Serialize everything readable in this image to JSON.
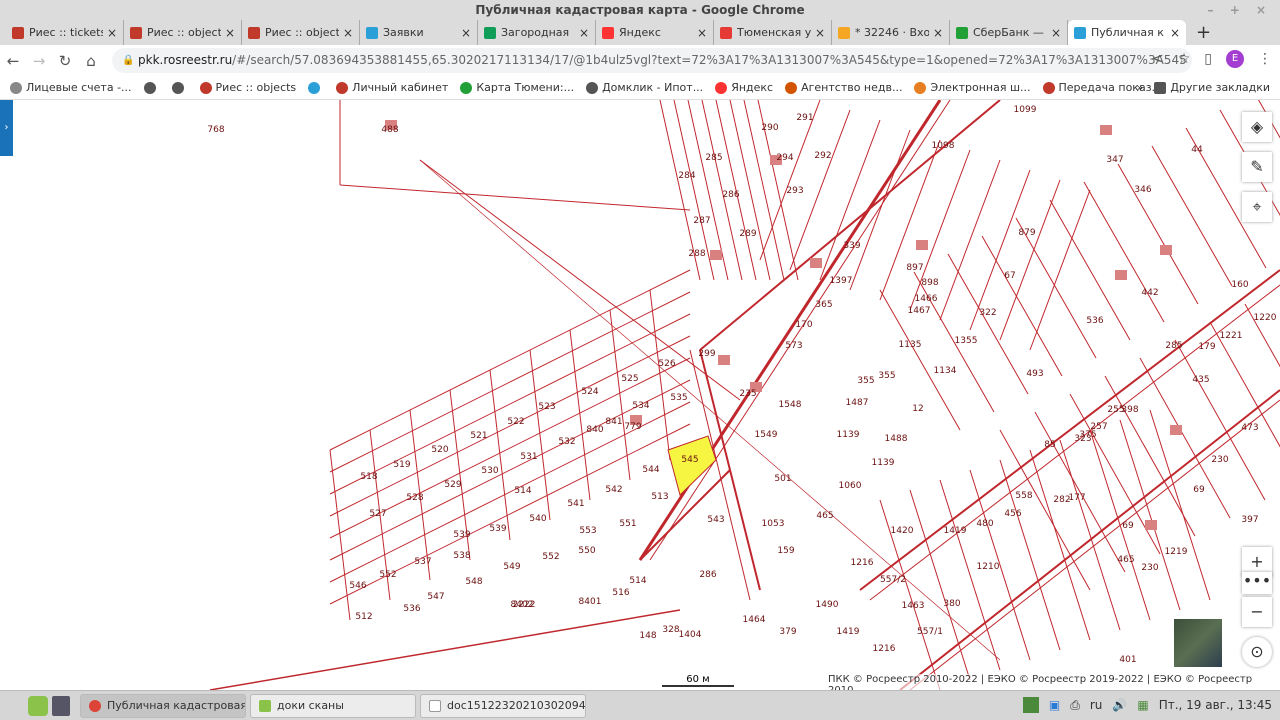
{
  "window": {
    "title": "Публичная кадастровая карта - Google Chrome"
  },
  "tabs": [
    {
      "label": "Риес :: tickets",
      "icon": "ries-icon",
      "color": "#c0392b"
    },
    {
      "label": "Риес :: objects",
      "icon": "ries-icon",
      "color": "#c0392b"
    },
    {
      "label": "Риес :: objects",
      "icon": "ries-icon",
      "color": "#c0392b"
    },
    {
      "label": "Заявки",
      "icon": "zayavki-icon",
      "color": "#2a9fd8"
    },
    {
      "label": "Загородная",
      "icon": "sheets-icon",
      "color": "#0f9d58"
    },
    {
      "label": "Яндекс",
      "icon": "yandex-icon",
      "color": "#f33"
    },
    {
      "label": "Тюменская у",
      "icon": "map-pin-icon",
      "color": "#e53935"
    },
    {
      "label": "* 32246 · Вхо",
      "icon": "mail-icon",
      "color": "#f5a623"
    },
    {
      "label": "СберБанк —",
      "icon": "sber-icon",
      "color": "#21a038"
    },
    {
      "label": "Публичная к",
      "icon": "rosreestr-icon",
      "color": "#2a9fd8",
      "active": true
    }
  ],
  "address": {
    "host": "pkk.rosreestr.ru",
    "path": "/#/search/57.083694353881455,65.3020217113134/17/@1b4ulz5vgl?text=72%3A17%3A1313007%3A545&type=1&opened=72%3A17%3A1313007%3A545",
    "profile": "E"
  },
  "bookmarks": [
    "Лицевые счета -...",
    "",
    "",
    "Риес :: objects",
    "",
    "Личный кабинет",
    "Карта Тюмени:...",
    "Домклик - Ипот...",
    "Яндекс",
    "Агентство недв...",
    "Электронная ш...",
    "Передача показ..."
  ],
  "other_bookmarks": "Другие закладки",
  "map": {
    "parcels": [
      "768",
      "488",
      "1099",
      "290",
      "291",
      "285",
      "294",
      "292",
      "1098",
      "284",
      "286",
      "293",
      "347",
      "346",
      "44",
      "287",
      "289",
      "339",
      "879",
      "897",
      "288",
      "1397",
      "898",
      "67",
      "442",
      "1466",
      "1467",
      "322",
      "536",
      "365",
      "170",
      "573",
      "1355",
      "1135",
      "1134",
      "493",
      "299",
      "526",
      "525",
      "524",
      "534",
      "535",
      "235",
      "1548",
      "355",
      "355",
      "1487",
      "12",
      "523",
      "522",
      "521",
      "840",
      "841",
      "779",
      "1549",
      "1139",
      "1488",
      "520",
      "532",
      "531",
      "519",
      "530",
      "529",
      "518",
      "528",
      "514",
      "527",
      "545",
      "544",
      "513",
      "1139",
      "1060",
      "501",
      "465",
      "543",
      "542",
      "541",
      "540",
      "539",
      "539",
      "538",
      "537",
      "552",
      "553",
      "551",
      "552",
      "550",
      "549",
      "548",
      "547",
      "536",
      "546",
      "512",
      "8402",
      "8401",
      "516",
      "514",
      "148",
      "2222",
      "328",
      "1404",
      "1464",
      "379",
      "1490",
      "1419",
      "1420",
      "1419",
      "480",
      "1210",
      "380",
      "557/1",
      "557/2",
      "1463",
      "1216",
      "1216",
      "1053",
      "159",
      "230",
      "69",
      "230",
      "69",
      "1219",
      "465",
      "401",
      "286",
      "1221",
      "1220",
      "435",
      "285",
      "179",
      "160",
      "473",
      "397",
      "398",
      "375",
      "323",
      "85",
      "255",
      "257",
      "282",
      "177",
      "558",
      "456"
    ],
    "selected_parcel": "545",
    "scale_label": "60 м",
    "attribution": "ПКК © Росреестр 2010-2022 | ЕЭКО © Росреестр 2019-2022 | ЕЭКО © Росреестр 2010",
    "line_color": "#c0272d",
    "selected_color": "#f5f542"
  },
  "taskbar": {
    "items": [
      "Публичная кадастровая ...",
      "доки сканы",
      "doc15122320210302094..."
    ],
    "lang": "ru",
    "clock": "Пт., 19 авг., 13:45"
  }
}
